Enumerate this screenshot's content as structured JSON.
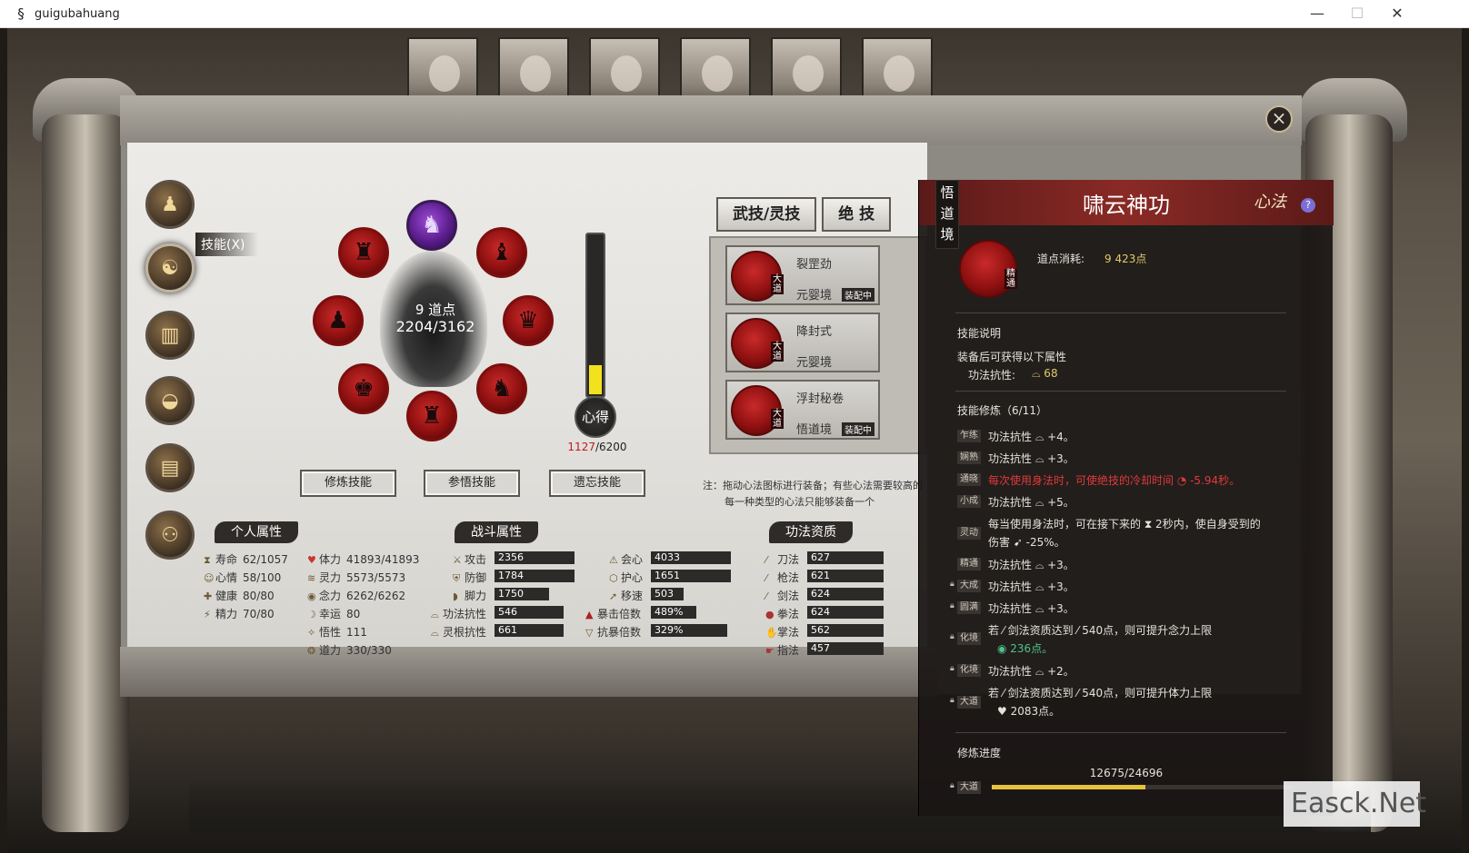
{
  "window": {
    "title": "guigubahuang",
    "minimize": "—",
    "maximize": "☐",
    "close": "✕"
  },
  "sidebar": {
    "active_label": "技能(X)"
  },
  "wheel": {
    "points_label": "9 道点",
    "progress": "2204/3162"
  },
  "gauge": {
    "label": "心得",
    "current": "1127",
    "max": "/6200",
    "fill_fraction": 0.1818
  },
  "actions": {
    "train": "修炼技能",
    "insight": "参悟技能",
    "forget": "遗忘技能"
  },
  "tabs": [
    "武技/灵技",
    "绝 技"
  ],
  "skills": [
    {
      "name": "裂罡劲",
      "realm": "元婴境",
      "badge": "大道",
      "equipped": "装配中"
    },
    {
      "name": "降封式",
      "realm": "元婴境",
      "badge": "大道",
      "equipped": ""
    },
    {
      "name": "浮封秘卷",
      "realm": "悟道境",
      "badge": "大道",
      "equipped": "装配中"
    }
  ],
  "note": {
    "line1": "注：拖动心法图标进行装备；有些心法需要较高的",
    "line2": "每一种类型的心法只能够装备一个"
  },
  "sections": {
    "personal": "个人属性",
    "combat": "战斗属性",
    "aptitude": "功法资质"
  },
  "personal": [
    {
      "label": "寿命",
      "value": "62/1057"
    },
    {
      "label": "心情",
      "value": "58/100"
    },
    {
      "label": "健康",
      "value": "80/80"
    },
    {
      "label": "精力",
      "value": "70/80"
    },
    {
      "label": "体力",
      "value": "41893/41893"
    },
    {
      "label": "灵力",
      "value": "5573/5573"
    },
    {
      "label": "念力",
      "value": "6262/6262"
    },
    {
      "label": "幸运",
      "value": "80"
    },
    {
      "label": "悟性",
      "value": "111"
    },
    {
      "label": "道力",
      "value": "330/330"
    }
  ],
  "combat": [
    {
      "label": "攻击",
      "value": "2356"
    },
    {
      "label": "防御",
      "value": "1784"
    },
    {
      "label": "脚力",
      "value": "1750"
    },
    {
      "label": "功法抗性",
      "value": "546"
    },
    {
      "label": "灵根抗性",
      "value": "661"
    },
    {
      "label": "会心",
      "value": "4033"
    },
    {
      "label": "护心",
      "value": "1651"
    },
    {
      "label": "移速",
      "value": "503"
    },
    {
      "label": "暴击倍数",
      "value": "489%"
    },
    {
      "label": "抗暴倍数",
      "value": "329%"
    }
  ],
  "aptitude": [
    {
      "label": "刀法",
      "value": "627"
    },
    {
      "label": "枪法",
      "value": "621"
    },
    {
      "label": "剑法",
      "value": "624"
    },
    {
      "label": "拳法",
      "value": "624"
    },
    {
      "label": "掌法",
      "value": "562"
    },
    {
      "label": "指法",
      "value": "457"
    }
  ],
  "detail": {
    "realm_tag": "悟道境",
    "title": "啸云神功",
    "category": "心法",
    "help": "?",
    "icon_badge": "精通",
    "cost_label": "道点消耗:",
    "cost_value": "9 423点",
    "desc_header": "技能说明",
    "desc_line": "装备后可获得以下属性",
    "resist_label": "功法抗性:",
    "resist_value": "⌓ 68",
    "train_header": "技能修炼（6/11）",
    "lines": [
      {
        "tier": "乍练",
        "text": "功法抗性 ⌓ +4。",
        "locked": false
      },
      {
        "tier": "娴熟",
        "text": "功法抗性 ⌓ +3。",
        "locked": false
      },
      {
        "tier": "通晓",
        "text": "每次使用身法时，可使绝技的冷却时间 ◔ -5.94秒。",
        "locked": false,
        "red": true
      },
      {
        "tier": "小成",
        "text": "功法抗性 ⌓ +5。",
        "locked": false
      },
      {
        "tier": "灵动",
        "text": "每当使用身法时，可在接下来的 ⧗ 2秒内，使自身受到的",
        "text2": "伤害 ➹ -25%。",
        "locked": false
      },
      {
        "tier": "精通",
        "text": "功法抗性 ⌓ +3。",
        "locked": false
      },
      {
        "tier": "大成",
        "text": "功法抗性 ⌓ +3。",
        "locked": true
      },
      {
        "tier": "圆满",
        "text": "功法抗性 ⌓ +3。",
        "locked": true
      },
      {
        "tier": "化境",
        "text": "若 ⁄ 剑法资质达到 ⁄ 540点，则可提升念力上限",
        "text2": "◉ 236点。",
        "locked": true
      },
      {
        "tier": "化境",
        "text": "功法抗性 ⌓ +2。",
        "locked": true
      },
      {
        "tier": "大道",
        "text": "若 ⁄ 剑法资质达到 ⁄ 540点，则可提升体力上限",
        "text2": "♥ 2083点。",
        "locked": true
      }
    ],
    "progress_header": "修炼进度",
    "progress_text": "12675/24696",
    "progress_fraction": 0.5132,
    "final_tier": "大道"
  },
  "watermark": "Easck.Net",
  "colors": {
    "accent_red": "#c92a2a",
    "gold": "#e0c96a",
    "gauge": "#f2e21d"
  }
}
